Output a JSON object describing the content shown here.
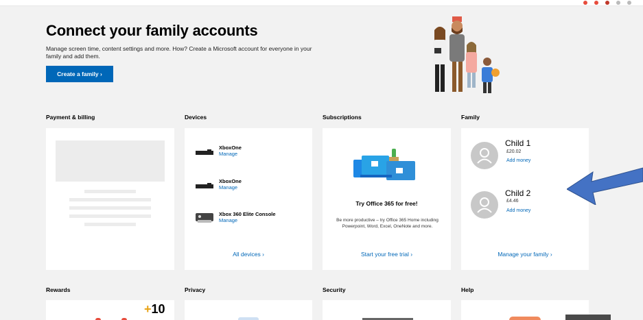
{
  "hero": {
    "title": "Connect your family accounts",
    "description": "Manage screen time, content settings and more. How? Create a Microsoft account for everyone in your family and add them.",
    "button_label": "Create a family ›"
  },
  "sections": {
    "payment": {
      "title": "Payment & billing"
    },
    "devices": {
      "title": "Devices",
      "items": [
        {
          "name": "XboxOne",
          "action": "Manage"
        },
        {
          "name": "XboxOne",
          "action": "Manage"
        },
        {
          "name": "Xbox 360 Elite Console",
          "action": "Manage"
        }
      ],
      "link": "All devices ›"
    },
    "subscriptions": {
      "title": "Subscriptions",
      "headline": "Try Office 365 for free!",
      "description": "Be more productive – try Office 365 Home including Powerpoint, Word, Excel, OneNote and more.",
      "link": "Start your free trial ›"
    },
    "family": {
      "title": "Family",
      "children": [
        {
          "name": "Child 1",
          "balance": "£20.02",
          "action": "Add money"
        },
        {
          "name": "Child 2",
          "balance": "£4.46",
          "action": "Add money"
        }
      ],
      "link": "Manage your family ›"
    },
    "rewards": {
      "title": "Rewards",
      "points_sign": "+",
      "points_value": "10"
    },
    "privacy": {
      "title": "Privacy"
    },
    "security": {
      "title": "Security"
    },
    "help": {
      "title": "Help"
    }
  },
  "colors": {
    "accent": "#0067b8",
    "background": "#f2f2f2",
    "annotation_arrow": "#4472c4"
  }
}
